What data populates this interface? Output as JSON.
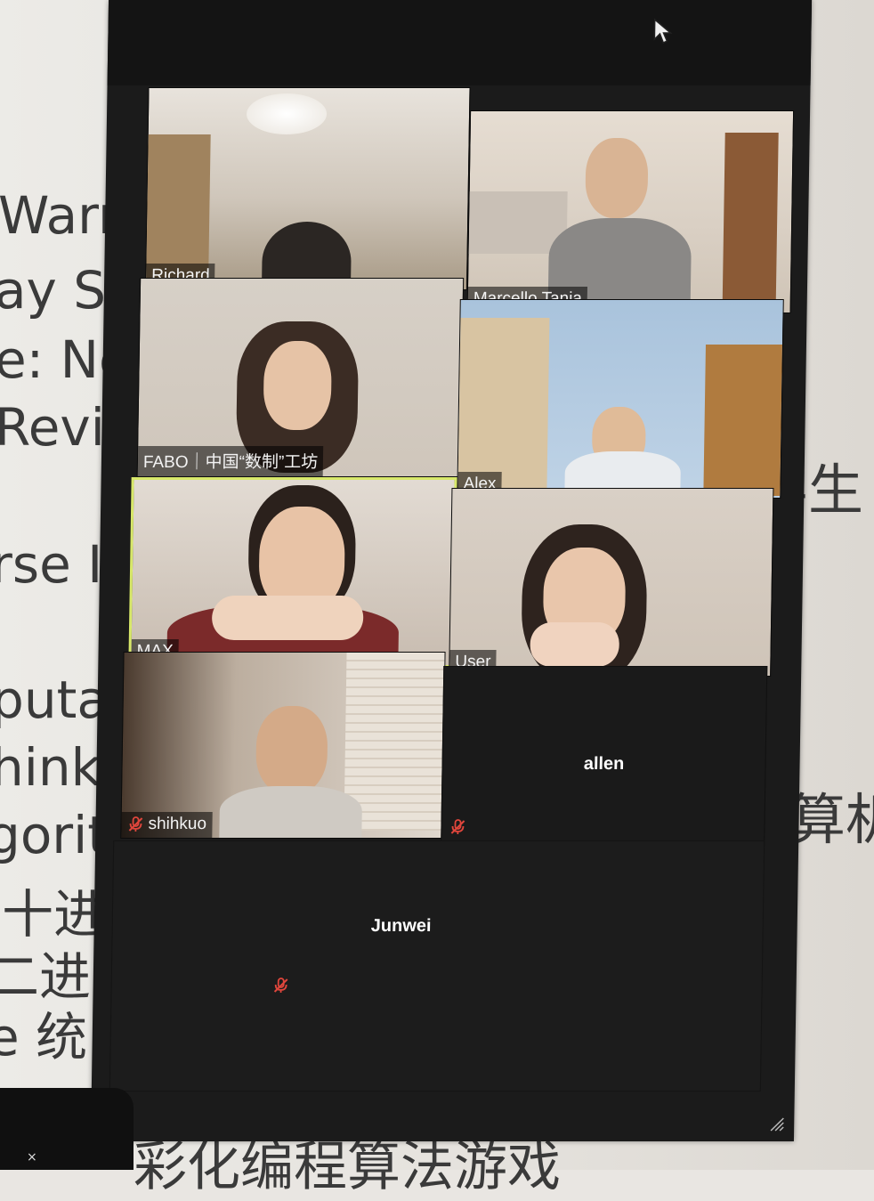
{
  "slide": {
    "left_lines": [
      "Warm",
      "ay Sha",
      "e: Nev",
      "Revie",
      "rse In",
      "putat",
      "hink",
      "gorit",
      "l十进",
      "二进",
      "e 统"
    ],
    "right_lines": [
      "学生",
      "计算机"
    ],
    "bottom_line": "彩化编程算法游戏"
  },
  "participants": [
    {
      "name": "Richard",
      "muted": false
    },
    {
      "name": "Marcello Tania",
      "muted": false
    },
    {
      "name": "FABO｜中国“数制”工坊",
      "muted": false
    },
    {
      "name": "Alex",
      "muted": false
    },
    {
      "name": "MAX",
      "muted": false,
      "active_speaker": true
    },
    {
      "name": "User",
      "muted": false
    },
    {
      "name": "shihkuo",
      "muted": true
    },
    {
      "name": "allen",
      "muted": true,
      "video_off": true
    },
    {
      "name": "Junwei",
      "muted": true,
      "video_off": true
    }
  ],
  "colors": {
    "window_bg": "#1b1b1b",
    "active_border": "#d8e86a",
    "mute_red": "#e0463c"
  },
  "icons": [
    "cursor-icon",
    "muted-mic-icon",
    "resize-handle-icon",
    "close-icon"
  ],
  "phone_corner": {
    "close_glyph": "×"
  }
}
